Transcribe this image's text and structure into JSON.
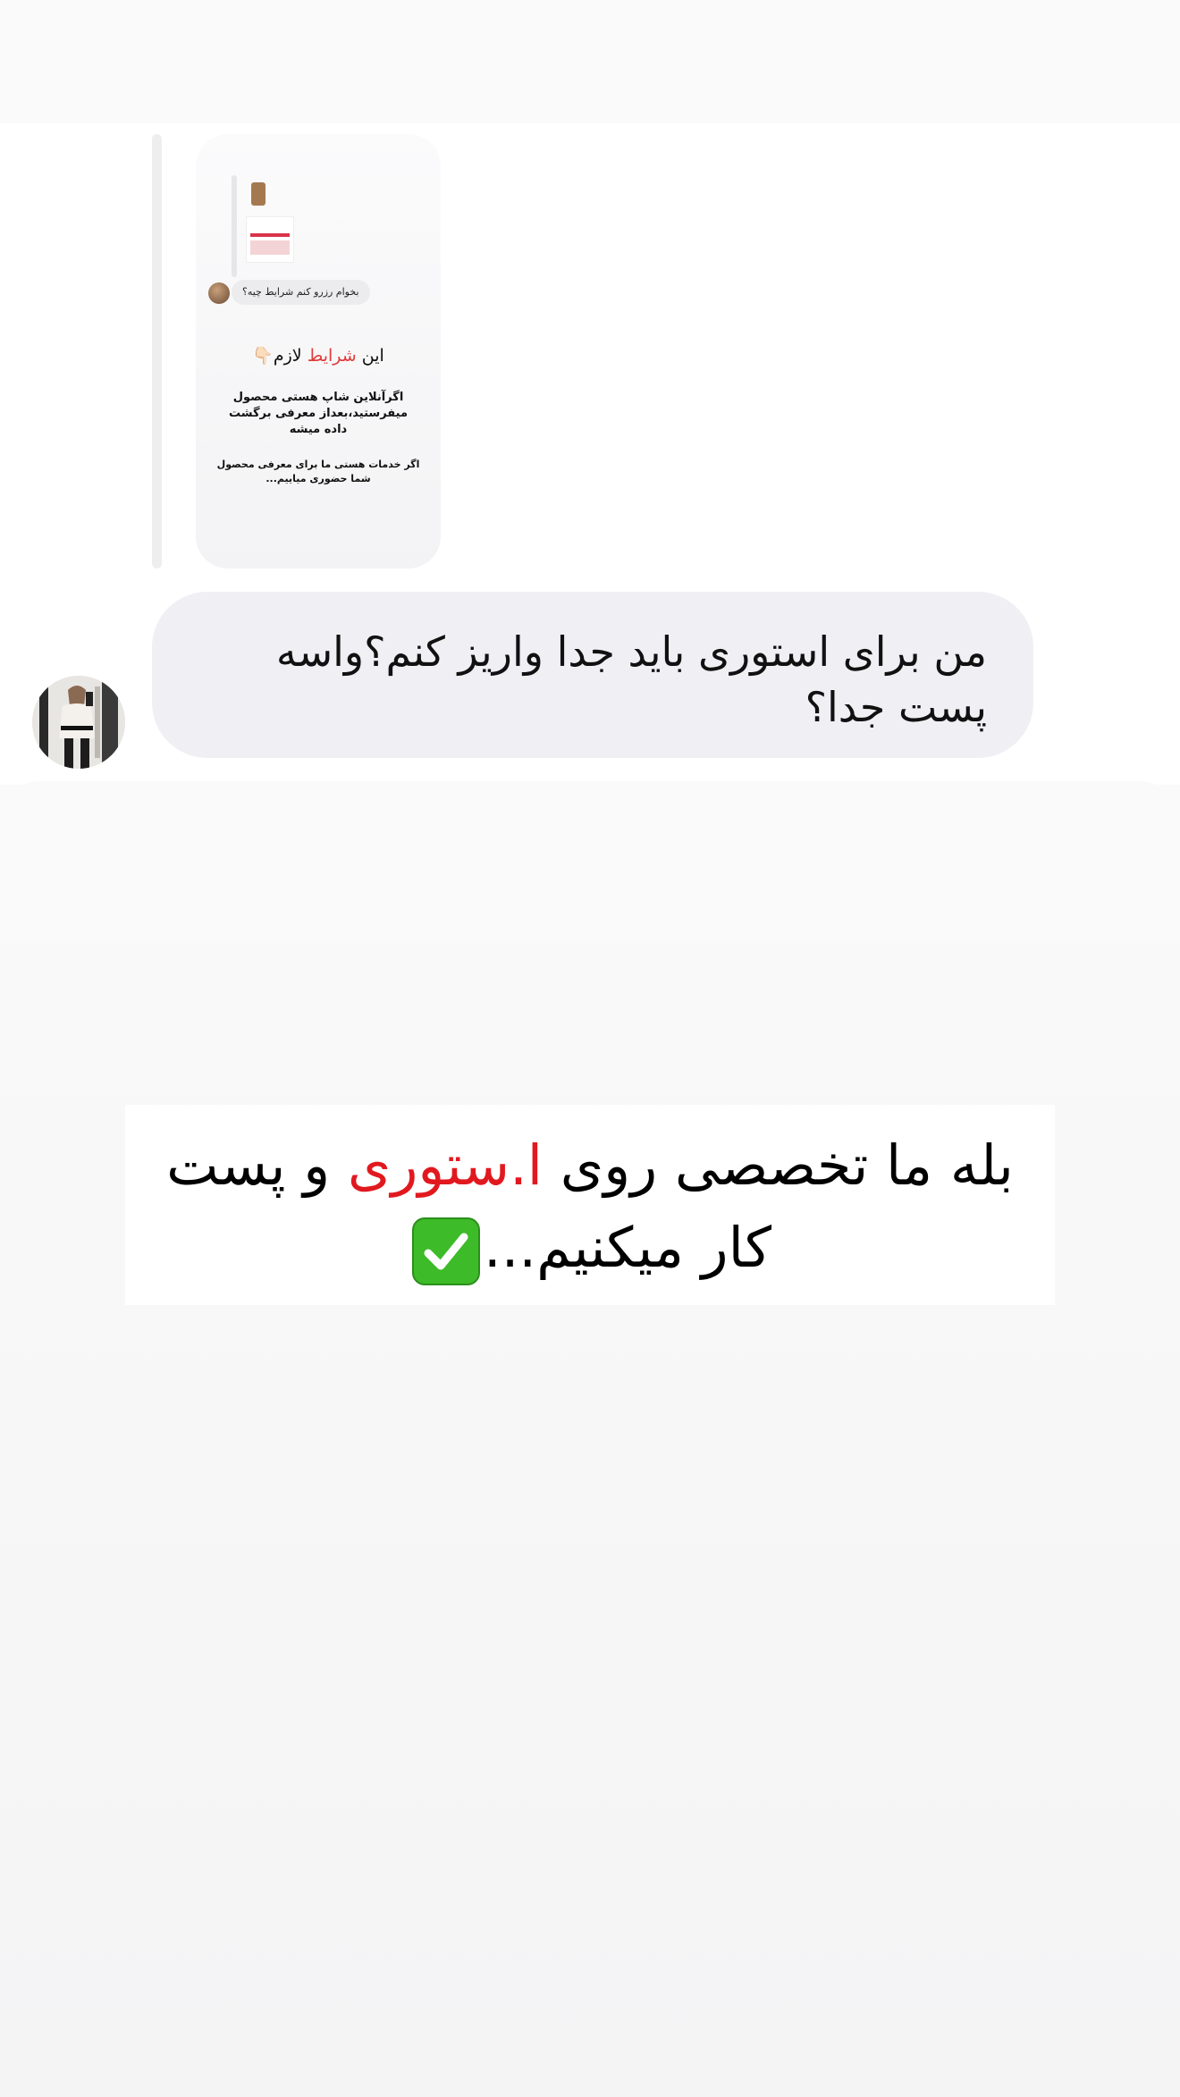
{
  "reply_preview": {
    "mini_question": "بخوام رزرو کنم شرایط چیه؟",
    "title_prefix": "این ",
    "title_highlight": "شرایط",
    "title_suffix": " لازم👇🏻",
    "paragraph_1": "اگرآنلاین شاپ هستی محصول میفرستید،بعداز معرفی برگشت داده میشه",
    "paragraph_2": "اگر خدمات هستی ما برای معرفی محصول شما حضوری میاییم..."
  },
  "message": {
    "text": "من برای استوری باید جدا واریز کنم؟واسه پست جدا؟"
  },
  "story_caption": {
    "part_1": "بله ما تخصصی روی ",
    "highlight": "ا.ستوری",
    "part_2": " و پست کار میکنیم...",
    "icon": "check-mark-button-icon"
  },
  "colors": {
    "highlight_red": "#e1191f",
    "bubble_gray": "#efeff4",
    "check_green": "#3dbb28"
  }
}
